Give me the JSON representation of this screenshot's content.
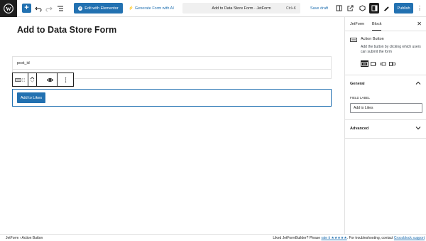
{
  "toolbar": {
    "elementor_label": "Edit with Elementor",
    "ai_label": "Generate Form with AI",
    "doc_title": "Add to Data Store Form · JetForm",
    "shortcut": "Ctrl+K",
    "save_draft": "Save draft",
    "publish": "Publish"
  },
  "canvas": {
    "page_title": "Add to Data Store Form",
    "field_value": "post_id",
    "button_label": "Add to Likes"
  },
  "sidebar": {
    "tabs": [
      "JetForm",
      "Block"
    ],
    "active_tab": "Block",
    "block_title": "Action Button",
    "block_desc": "Add the button by clicking which users can submit the form",
    "general_title": "General",
    "field_label_caption": "FIELD LABEL",
    "field_label_value": "Add to Likes",
    "advanced_title": "Advanced"
  },
  "footer": {
    "crumb_root": "JetForm",
    "crumb_sep": "›",
    "crumb_current": "Action Button",
    "promo_prefix": "Liked JetFormBuilder? Please",
    "promo_rate": "rate it ★★★★★",
    "promo_middle": ". For troubleshooting, contact",
    "promo_link": "Crocoblock support"
  },
  "colors": {
    "accent": "#2271b1",
    "dark": "#1e1e1e"
  }
}
